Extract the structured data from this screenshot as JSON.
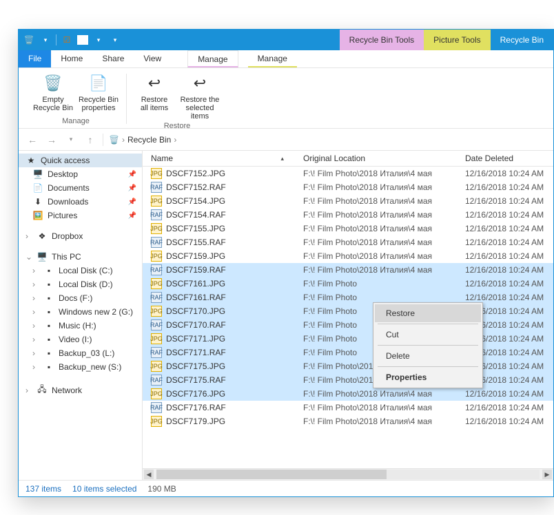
{
  "titlebar": {
    "tool_tabs": [
      {
        "label": "Recycle Bin Tools",
        "cls": "pink"
      },
      {
        "label": "Picture Tools",
        "cls": "yellow"
      },
      {
        "label": "Recycle Bin",
        "cls": "blue"
      }
    ]
  },
  "ribbon_tabs": {
    "file": "File",
    "tabs": [
      "Home",
      "Share",
      "View"
    ],
    "manage1": "Manage",
    "manage2": "Manage"
  },
  "ribbon": {
    "groups": [
      {
        "label": "Manage",
        "items": [
          {
            "label": "Empty\nRecycle Bin",
            "icon": "🗑️"
          },
          {
            "label": "Recycle Bin\nproperties",
            "icon": "📄"
          }
        ]
      },
      {
        "label": "Restore",
        "items": [
          {
            "label": "Restore\nall items",
            "icon": "↩"
          },
          {
            "label": "Restore the\nselected items",
            "icon": "↩"
          }
        ]
      }
    ]
  },
  "address": {
    "crumbs": [
      "Recycle Bin"
    ]
  },
  "sidebar": {
    "quick_access": {
      "label": "Quick access",
      "items": [
        {
          "icon": "🖥️",
          "label": "Desktop",
          "pin": true
        },
        {
          "icon": "📄",
          "label": "Documents",
          "pin": true
        },
        {
          "icon": "⬇",
          "label": "Downloads",
          "pin": true
        },
        {
          "icon": "🖼️",
          "label": "Pictures",
          "pin": true
        }
      ]
    },
    "dropbox": {
      "icon": "❖",
      "label": "Dropbox"
    },
    "thispc": {
      "label": "This PC",
      "items": [
        {
          "label": "Local Disk (C:)"
        },
        {
          "label": "Local Disk (D:)"
        },
        {
          "label": "Docs (F:)"
        },
        {
          "label": "Windows new 2 (G:)"
        },
        {
          "label": "Music (H:)"
        },
        {
          "label": "Video (I:)"
        },
        {
          "label": "Backup_03 (L:)"
        },
        {
          "label": "Backup_new (S:)"
        }
      ]
    },
    "network": {
      "label": "Network"
    }
  },
  "columns": {
    "name": "Name",
    "loc": "Original Location",
    "date": "Date Deleted"
  },
  "location_full": "F:\\! Film Photo\\2018 Италия\\4 мая",
  "location_trunc": "F:\\! Film Photo",
  "date_val": "12/16/2018 10:24 AM",
  "rows": [
    {
      "name": "DSCF7152.JPG",
      "type": "jpg",
      "sel": false,
      "trunc": false
    },
    {
      "name": "DSCF7152.RAF",
      "type": "raf",
      "sel": false,
      "trunc": false
    },
    {
      "name": "DSCF7154.JPG",
      "type": "jpg",
      "sel": false,
      "trunc": false
    },
    {
      "name": "DSCF7154.RAF",
      "type": "raf",
      "sel": false,
      "trunc": false
    },
    {
      "name": "DSCF7155.JPG",
      "type": "jpg",
      "sel": false,
      "trunc": false
    },
    {
      "name": "DSCF7155.RAF",
      "type": "raf",
      "sel": false,
      "trunc": false
    },
    {
      "name": "DSCF7159.JPG",
      "type": "jpg",
      "sel": false,
      "trunc": false
    },
    {
      "name": "DSCF7159.RAF",
      "type": "raf",
      "sel": true,
      "trunc": false
    },
    {
      "name": "DSCF7161.JPG",
      "type": "jpg",
      "sel": true,
      "trunc": true
    },
    {
      "name": "DSCF7161.RAF",
      "type": "raf",
      "sel": true,
      "trunc": true
    },
    {
      "name": "DSCF7170.JPG",
      "type": "jpg",
      "sel": true,
      "trunc": true
    },
    {
      "name": "DSCF7170.RAF",
      "type": "raf",
      "sel": true,
      "trunc": true
    },
    {
      "name": "DSCF7171.JPG",
      "type": "jpg",
      "sel": true,
      "trunc": true
    },
    {
      "name": "DSCF7171.RAF",
      "type": "raf",
      "sel": true,
      "trunc": true
    },
    {
      "name": "DSCF7175.JPG",
      "type": "jpg",
      "sel": true,
      "trunc": false
    },
    {
      "name": "DSCF7175.RAF",
      "type": "raf",
      "sel": true,
      "trunc": false
    },
    {
      "name": "DSCF7176.JPG",
      "type": "jpg",
      "sel": true,
      "trunc": false
    },
    {
      "name": "DSCF7176.RAF",
      "type": "raf",
      "sel": false,
      "trunc": false
    },
    {
      "name": "DSCF7179.JPG",
      "type": "jpg",
      "sel": false,
      "trunc": false
    }
  ],
  "context_menu": {
    "items": [
      {
        "label": "Restore",
        "hover": true
      },
      {
        "sep": true
      },
      {
        "label": "Cut"
      },
      {
        "sep": true
      },
      {
        "label": "Delete"
      },
      {
        "sep": true
      },
      {
        "label": "Properties",
        "bold": true
      }
    ]
  },
  "status": {
    "count": "137 items",
    "selected": "10 items selected",
    "size": "190 MB"
  }
}
